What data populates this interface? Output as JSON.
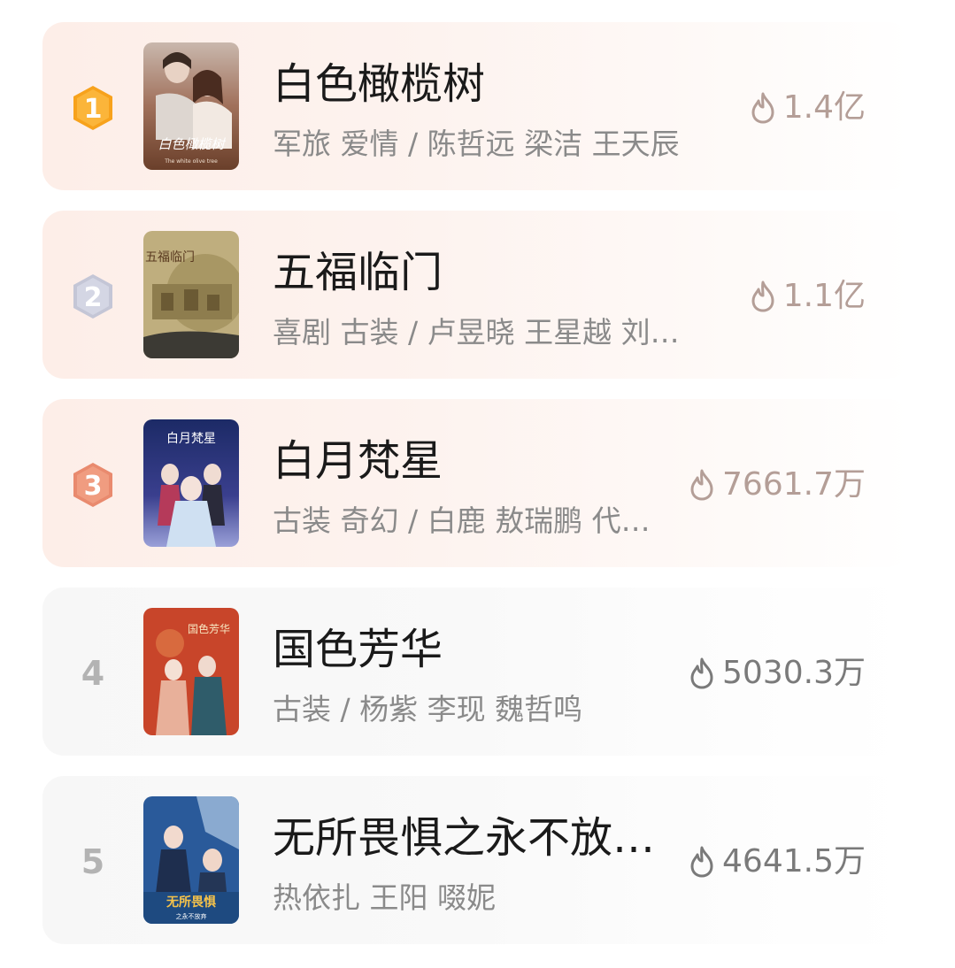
{
  "colors": {
    "gold": "#f7a21c",
    "silver": "#c4c6d6",
    "bronze": "#e98a6e",
    "heat_top": "#b49e97",
    "heat_plain": "#7a7a7a"
  },
  "items": [
    {
      "rank": "1",
      "title": "白色橄榄树",
      "tags": "军旅 爱情 / 陈哲远 梁洁 王天辰",
      "heat": "1.4亿",
      "poster_text": "白色橄榄树",
      "poster_subtitle": "The white olive tree"
    },
    {
      "rank": "2",
      "title": "五福临门",
      "tags": "喜剧 古装 / 卢昱晓 王星越 刘…",
      "heat": "1.1亿",
      "poster_text": "五福临门"
    },
    {
      "rank": "3",
      "title": "白月梵星",
      "tags": "古装 奇幻 / 白鹿 敖瑞鹏 代…",
      "heat": "7661.7万",
      "poster_text": "白月梵星"
    },
    {
      "rank": "4",
      "title": "国色芳华",
      "tags": "古装 / 杨紫 李现 魏哲鸣",
      "heat": "5030.3万",
      "poster_text": "国色芳华"
    },
    {
      "rank": "5",
      "title": "无所畏惧之永不放…",
      "tags": "热依扎 王阳 啜妮",
      "heat": "4641.5万",
      "poster_text": "无所畏惧",
      "poster_subtitle": "之永不放弃"
    }
  ]
}
